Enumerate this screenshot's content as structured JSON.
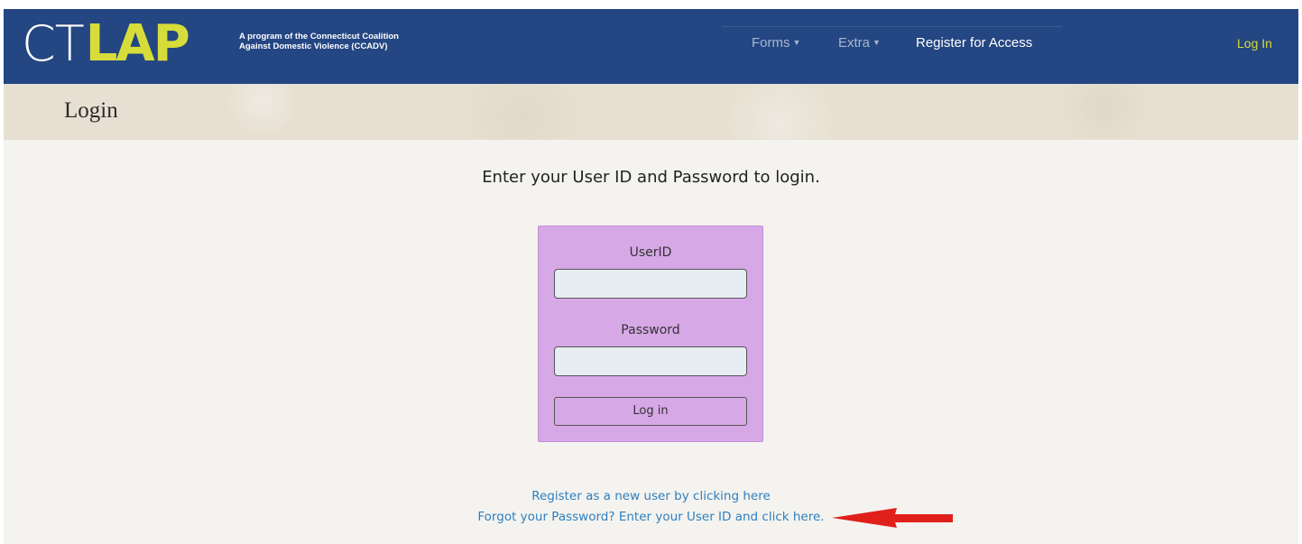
{
  "header": {
    "logo_ct": "CT",
    "logo_lap": "LAP",
    "logo_tagline_line1": "A program of the Connecticut Coalition",
    "logo_tagline_line2": "Against Domestic Violence (CCADV)",
    "nav": {
      "forms": "Forms",
      "extra": "Extra",
      "register": "Register for Access",
      "login": "Log In"
    }
  },
  "page": {
    "title": "Login",
    "instructions": "Enter your User ID and Password to login."
  },
  "login_form": {
    "userid_label": "UserID",
    "userid_value": "",
    "password_label": "Password",
    "password_value": "",
    "submit_label": "Log in"
  },
  "links": {
    "register": "Register as a new user by clicking here",
    "forgot": "Forgot your Password? Enter your User ID and click here."
  },
  "colors": {
    "navbar": "#244682",
    "logo_accent": "#d6dd3a",
    "card": "#d7a8e6",
    "link": "#2f7fbf",
    "annotation_arrow": "#e0201b"
  },
  "icons": {
    "dropdown": "caret-down-icon",
    "annotation": "red-arrow-icon"
  }
}
